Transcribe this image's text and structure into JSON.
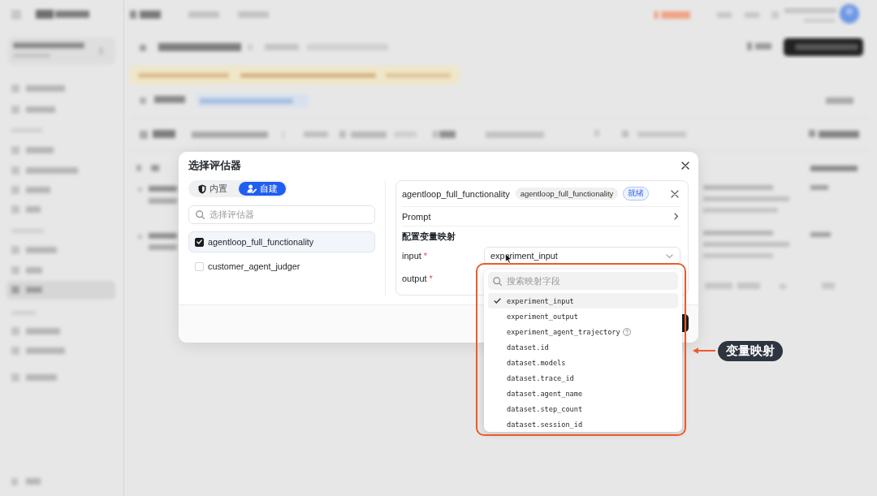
{
  "dialog": {
    "title": "选择评估器"
  },
  "source_tabs": [
    {
      "label": "内置",
      "selected": false
    },
    {
      "label": "自建",
      "selected": true
    }
  ],
  "evaluator_search": {
    "placeholder": "选择评估器"
  },
  "evaluators": [
    {
      "name": "agentloop_full_functionality",
      "checked": true,
      "selected": true
    },
    {
      "name": "customer_agent_judger",
      "checked": false,
      "selected": false
    }
  ],
  "detail": {
    "title": "agentloop_full_functionality",
    "tag": "agentloop_full_functionality",
    "status": "就绪",
    "prompt": "Prompt",
    "mapping_title": "配置变量映射",
    "fields": [
      {
        "label": "input",
        "required_mark": "*",
        "value": "experiment_input"
      },
      {
        "label": "output",
        "required_mark": "*"
      }
    ]
  },
  "mapping_dropdown": {
    "search_placeholder": "搜索映射字段",
    "options": [
      {
        "label": "experiment_input",
        "selected": true,
        "help": false
      },
      {
        "label": "experiment_output",
        "selected": false,
        "help": false
      },
      {
        "label": "experiment_agent_trajectory",
        "selected": false,
        "help": true
      },
      {
        "label": "dataset.id",
        "selected": false,
        "help": false
      },
      {
        "label": "dataset.models",
        "selected": false,
        "help": false
      },
      {
        "label": "dataset.trace_id",
        "selected": false,
        "help": false
      },
      {
        "label": "dataset.agent_name",
        "selected": false,
        "help": false
      },
      {
        "label": "dataset.step_count",
        "selected": false,
        "help": false
      },
      {
        "label": "dataset.session_id",
        "selected": false,
        "help": false
      }
    ]
  },
  "annotation": {
    "label": "变量映射"
  }
}
